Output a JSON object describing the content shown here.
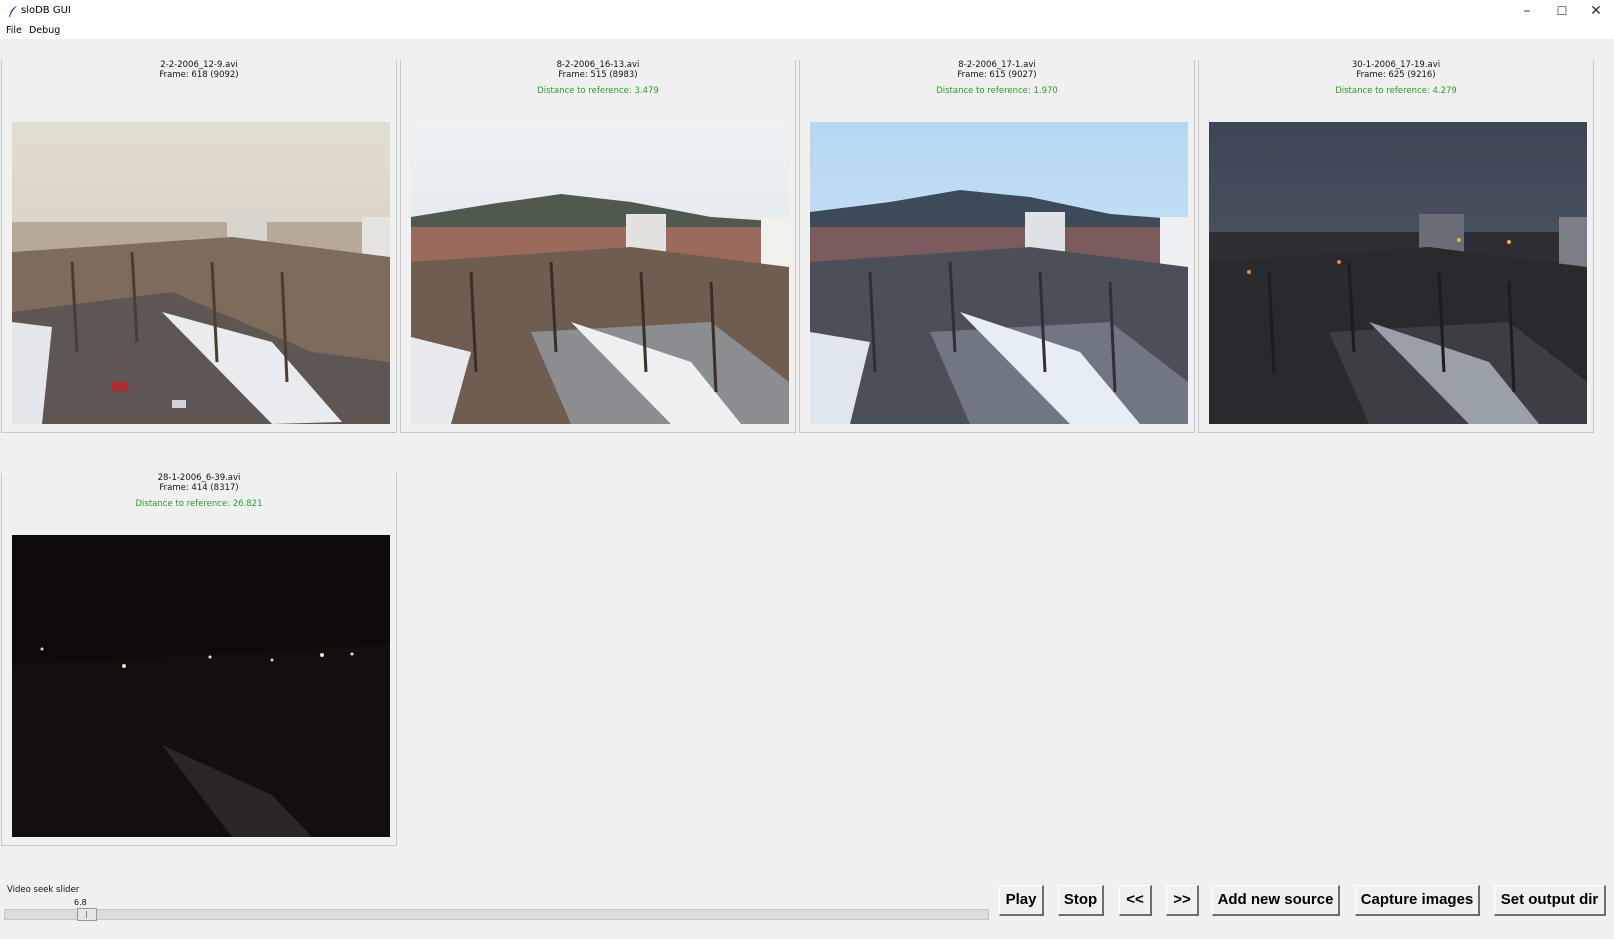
{
  "window": {
    "title": "sloDB GUI",
    "controls": {
      "minimize": "–",
      "maximize": "☐",
      "close": "✕"
    }
  },
  "menu": [
    {
      "label": "File"
    },
    {
      "label": "Debug"
    }
  ],
  "panels": [
    {
      "filename": "2-2-2006_12-9.avi",
      "frame": "Frame: 618 (9092)",
      "distance": "",
      "scene": "fog"
    },
    {
      "filename": "8-2-2006_16-13.avi",
      "frame": "Frame: 515 (8983)",
      "distance": "Distance to reference: 3.479",
      "scene": "day"
    },
    {
      "filename": "8-2-2006_17-1.avi",
      "frame": "Frame: 615 (9027)",
      "distance": "Distance to reference: 1.970",
      "scene": "blue"
    },
    {
      "filename": "30-1-2006_17-19.avi",
      "frame": "Frame: 625 (9216)",
      "distance": "Distance to reference: 4.279",
      "scene": "dusk"
    },
    {
      "filename": "28-1-2006_6-39.avi",
      "frame": "Frame: 414 (8317)",
      "distance": "Distance to reference: 26.821",
      "scene": "night"
    }
  ],
  "seek": {
    "label": "Video seek slider",
    "value": "6.8",
    "position_fraction": 0.075
  },
  "buttons": [
    {
      "label": "Play"
    },
    {
      "label": "Stop"
    },
    {
      "label": "<<"
    },
    {
      "label": ">>"
    },
    {
      "label": "Add new source"
    },
    {
      "label": "Capture images"
    },
    {
      "label": "Set output dir"
    }
  ],
  "colors": {
    "background": "#f0f0f0",
    "distance_text": "#2a9a2a"
  }
}
